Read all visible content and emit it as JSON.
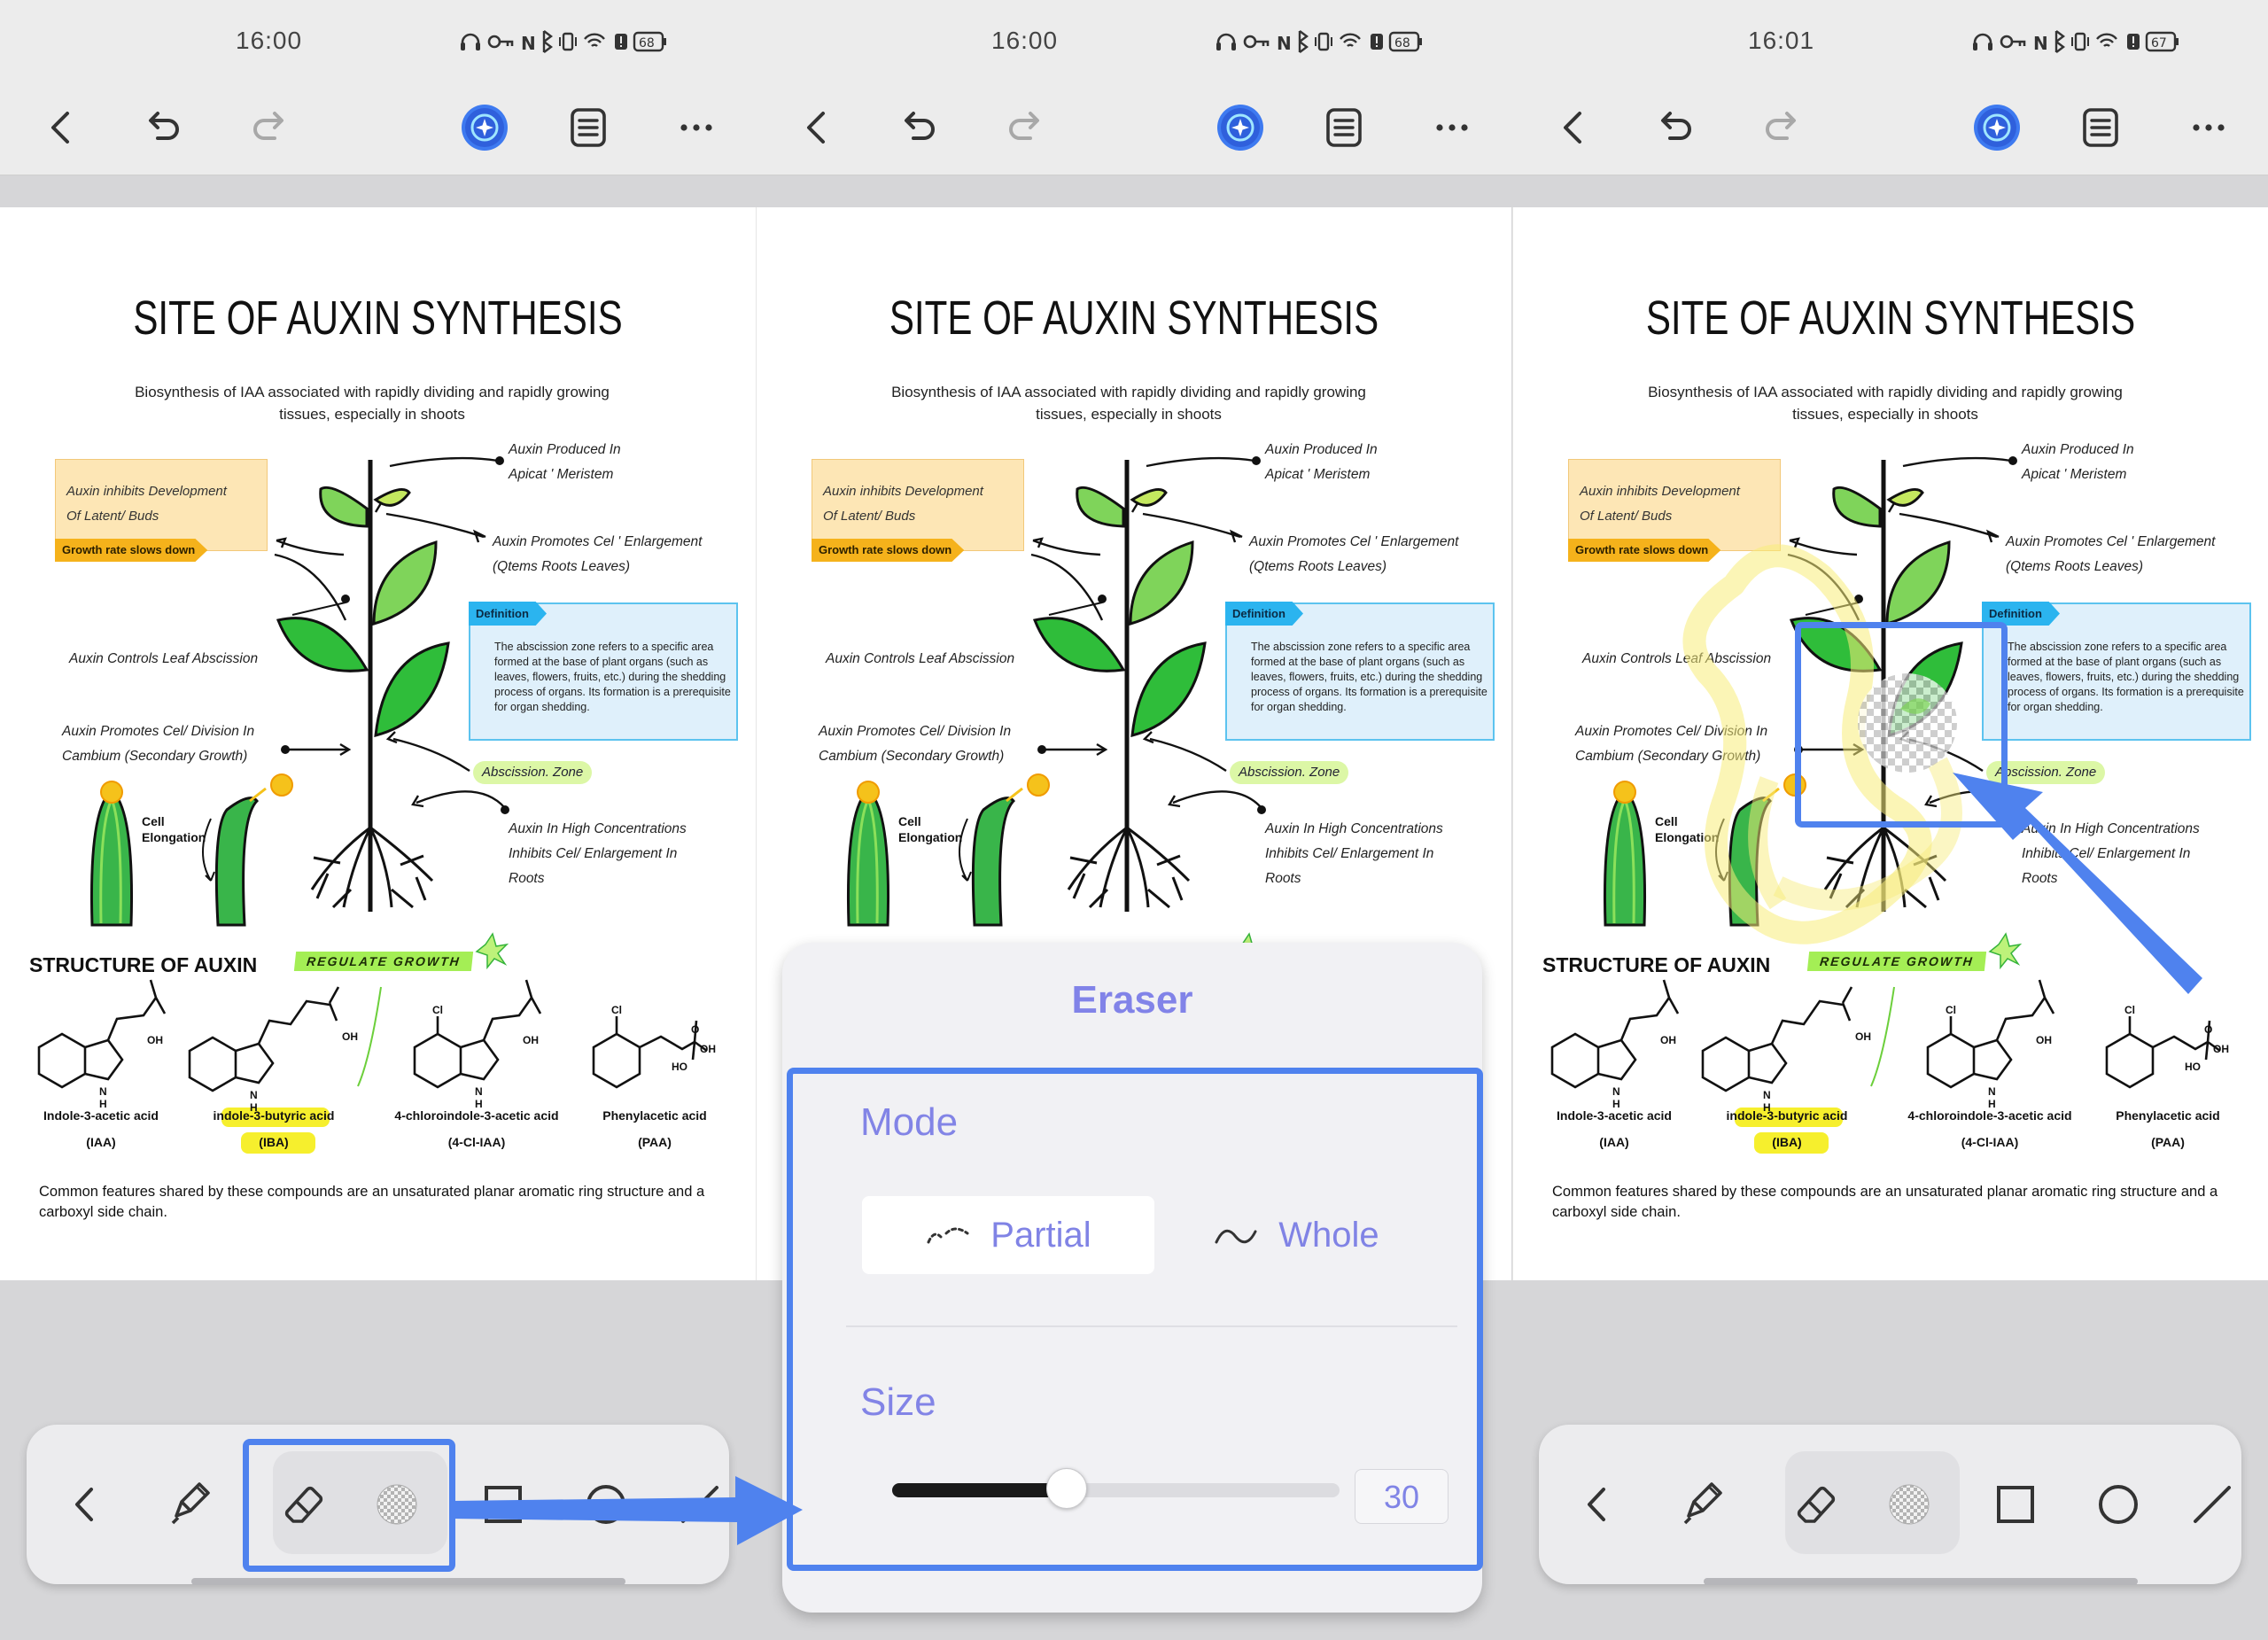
{
  "status_bar": {
    "times": [
      "16:00",
      "16:00",
      "16:01"
    ],
    "batteries": [
      "68",
      "68",
      "67"
    ]
  },
  "document": {
    "title": "SITE OF AUXIN SYNTHESIS",
    "subtitle": "Biosynthesis of IAA associated with rapidly dividing and rapidly growing tissues, especially in shoots",
    "note_inhibits": [
      "Auxin inhibits Development",
      "Of Latent/ Buds"
    ],
    "tag_growth": "Growth rate slows down",
    "label_produced": [
      "Auxin Produced In",
      "Apicat ' Meristem"
    ],
    "label_promotes_cell": [
      "Auxin Promotes Cel ' Enlargement",
      "(Qtems Roots Leaves)"
    ],
    "definition_tag": "Definition",
    "definition_text": "The abscission zone refers to a specific area formed at the base of plant organs (such as leaves, flowers, fruits, etc.) during the shedding process of organs. Its formation is a prerequisite for organ shedding.",
    "label_controls": "Auxin Controls Leaf Abscission",
    "label_division": [
      "Auxin Promotes Cel/ Division In",
      "Cambium (Secondary Growth)"
    ],
    "abscission_zone": "Abscission. Zone",
    "cell_elongation": [
      "Cell",
      "Elongation"
    ],
    "label_high_conc": [
      "Auxin In High Concentrations",
      "Inhibits Cel/ Enlargement In",
      "Roots"
    ],
    "structure_title": "STRUCTURE OF AUXIN",
    "regulate_growth": "REGULATE GROWTH",
    "compounds": [
      {
        "name": "Indole-3-acetic acid",
        "abbr": "(IAA)"
      },
      {
        "name": "indole-3-butyric acid",
        "abbr": "(IBA)"
      },
      {
        "name": "4-chloroindole-3-acetic acid",
        "abbr": "(4-Cl-IAA)"
      },
      {
        "name": "Phenylacetic acid",
        "abbr": "(PAA)"
      }
    ],
    "common_features": "Common features shared by these compounds are an unsaturated planar aromatic ring structure and a carboxyl side chain."
  },
  "eraser_popup": {
    "title": "Eraser",
    "mode_label": "Mode",
    "mode_options": [
      "Partial",
      "Whole"
    ],
    "selected_mode": "Partial",
    "size_label": "Size",
    "size_value": "30",
    "size_fraction": 0.39
  },
  "colors": {
    "accent": "#4f82ee",
    "popup_text": "#8284e6",
    "highlight": "#f6ef2d"
  }
}
